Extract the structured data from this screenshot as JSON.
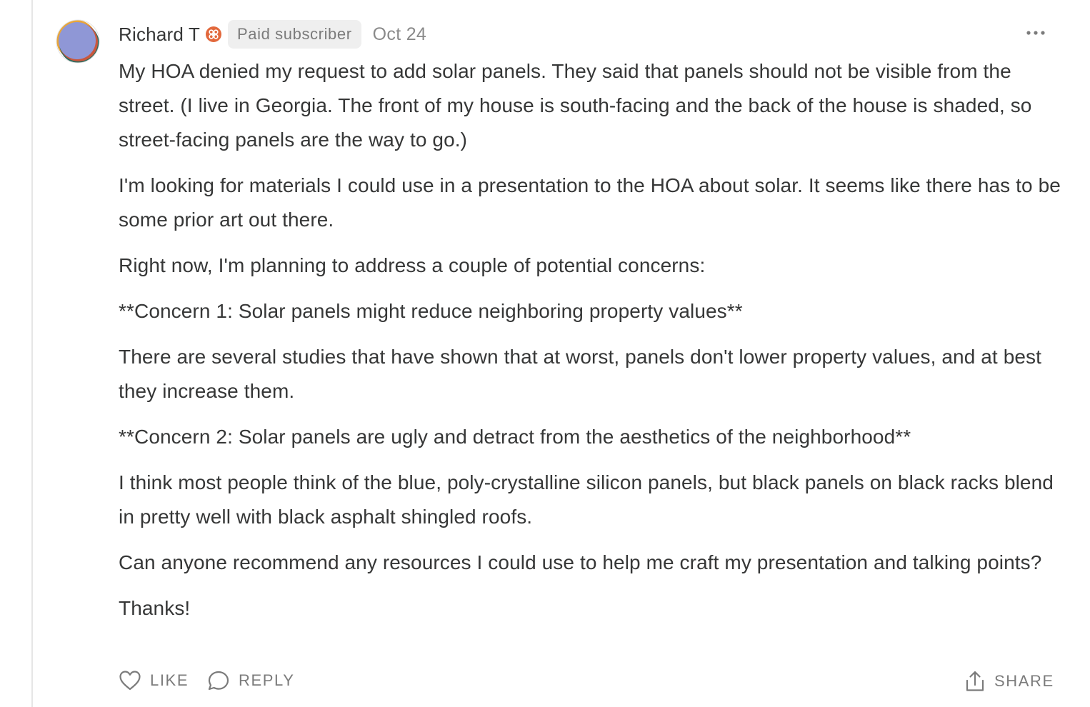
{
  "comment": {
    "author": "Richard T",
    "badge": "Paid subscriber",
    "date": "Oct 24",
    "subscriber_icon": "subscriber-badge-icon",
    "avatar_colors": [
      "#e8a63a",
      "#2d6b5e",
      "#c9573d",
      "#8f97d6"
    ],
    "paragraphs": [
      "My HOA denied my request to add solar panels. They said that panels should not be visible from the street. (I live in Georgia. The front of my house is south-facing and the back of the house is shaded, so street-facing panels are the way to go.)",
      "I'm looking for materials I could use in a presentation to the HOA about solar. It seems like there has to be some prior art out there.",
      "Right now, I'm planning to address a couple of potential concerns:",
      "**Concern 1: Solar panels might reduce neighboring property values**",
      "There are several studies that have shown that at worst, panels don't lower property values, and at best they increase them.",
      "**Concern 2: Solar panels are ugly and detract from the aesthetics of the neighborhood**",
      "I think most people think of the blue, poly-crystalline silicon panels, but black panels on black racks blend in pretty well with black asphalt shingled roofs.",
      "Can anyone recommend any resources I could use to help me craft my presentation and talking points?",
      "Thanks!"
    ]
  },
  "actions": {
    "like_label": "LIKE",
    "reply_label": "REPLY",
    "share_label": "SHARE"
  },
  "colors": {
    "text": "#363737",
    "muted": "#7b7b7b",
    "badge_bg": "#efefef",
    "subscriber_accent": "#e2683c"
  }
}
